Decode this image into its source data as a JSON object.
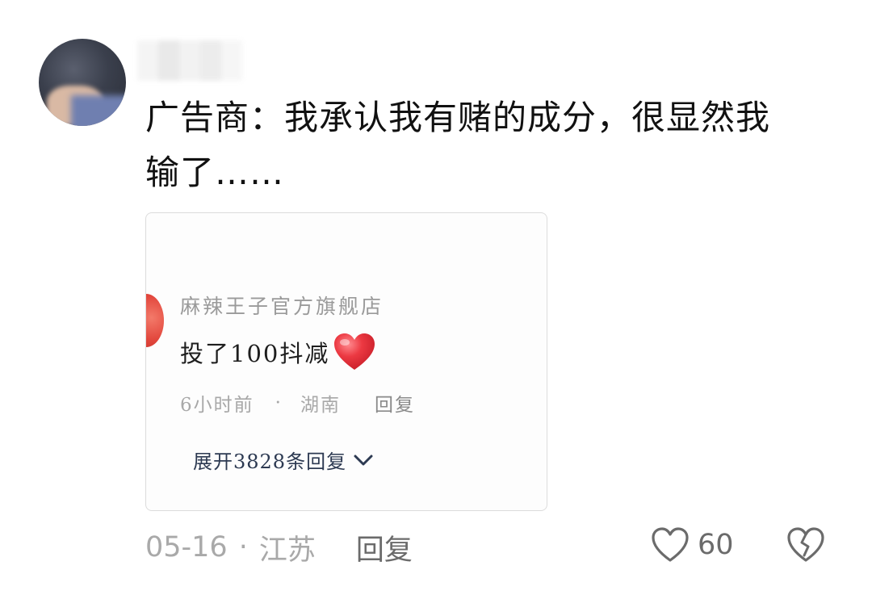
{
  "comment": {
    "text_line1": "广告商：我承认我有赌的成分，很显然我",
    "text_line2": "输了……"
  },
  "quoted": {
    "shop_name": "麻辣王子官方旗舰店",
    "reply_text": "投了100抖减",
    "reply_emoji": "red-heart-icon",
    "time": "6小时前",
    "location": "湖南",
    "dot": "·",
    "reply_label": "回复",
    "expand_label": "展开3828条回复"
  },
  "footer": {
    "date": "05-16",
    "sep": "·",
    "location": "江苏",
    "reply_label": "回复",
    "like_count": "60"
  },
  "colors": {
    "heart_red": "#e8303a",
    "meta_gray": "#a9a9a9",
    "expand_navy": "#2d3a52"
  }
}
